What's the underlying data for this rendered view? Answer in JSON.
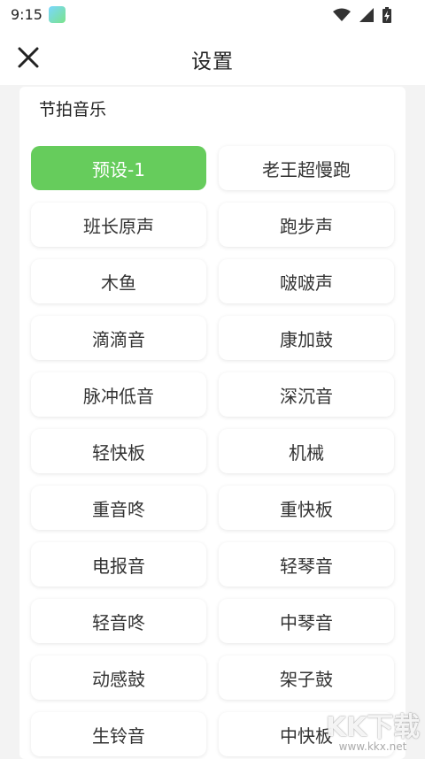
{
  "status": {
    "time": "9:15"
  },
  "header": {
    "title": "设置",
    "close_icon": "close-icon"
  },
  "section": {
    "title": "节拍音乐"
  },
  "options": [
    {
      "label": "预设-1",
      "selected": true
    },
    {
      "label": "老王超慢跑",
      "selected": false
    },
    {
      "label": "班长原声",
      "selected": false
    },
    {
      "label": "跑步声",
      "selected": false
    },
    {
      "label": "木鱼",
      "selected": false
    },
    {
      "label": "啵啵声",
      "selected": false
    },
    {
      "label": "滴滴音",
      "selected": false
    },
    {
      "label": "康加鼓",
      "selected": false
    },
    {
      "label": "脉冲低音",
      "selected": false
    },
    {
      "label": "深沉音",
      "selected": false
    },
    {
      "label": "轻快板",
      "selected": false
    },
    {
      "label": "机械",
      "selected": false
    },
    {
      "label": "重音咚",
      "selected": false
    },
    {
      "label": "重快板",
      "selected": false
    },
    {
      "label": "电报音",
      "selected": false
    },
    {
      "label": "轻琴音",
      "selected": false
    },
    {
      "label": "轻音咚",
      "selected": false
    },
    {
      "label": "中琴音",
      "selected": false
    },
    {
      "label": "动感鼓",
      "selected": false
    },
    {
      "label": "架子鼓",
      "selected": false
    },
    {
      "label": "生铃音",
      "selected": false
    },
    {
      "label": "中快板",
      "selected": false
    }
  ],
  "colors": {
    "accent": "#66cc5c",
    "background": "#f3f3f3"
  },
  "watermark": {
    "main": "KK下载",
    "url": "www.kkx.net"
  }
}
